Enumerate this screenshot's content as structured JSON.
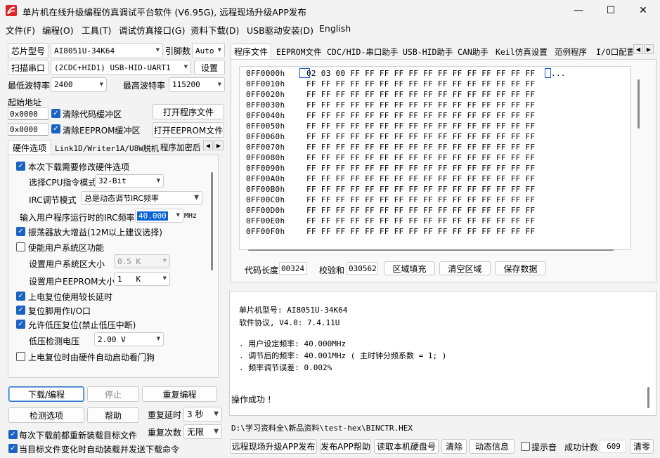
{
  "window": {
    "title": "单片机在线升级编程仿真调试平台软件 (V6.95G), 远程现场升级APP发布",
    "minimize": "—",
    "maximize": "☐",
    "close": "✕"
  },
  "menu": [
    "文件(F)",
    "编程(O)",
    "工具(T)",
    "调试仿真接口(G)",
    "资料下载(D)",
    "USB驱动安装(D)",
    "English"
  ],
  "left": {
    "chip_label": "芯片型号",
    "chip_value": "AI8051U-34K64",
    "pins_label": "引脚数",
    "pins_value": "Auto",
    "scan_label": "扫描串口",
    "port_value": "(2CDC+HID1) USB-HID-UART1",
    "settings_label": "设置",
    "min_baud_label": "最低波特率",
    "min_baud_value": "2400",
    "max_baud_label": "最高波特率",
    "max_baud_value": "115200",
    "start_addr_label": "起始地址",
    "code_addr": "0x0000",
    "clear_code_label": "清除代码缓冲区",
    "open_prog_label": "打开程序文件",
    "eeprom_addr": "0x0000",
    "clear_eeprom_label": "清除EEPROM缓冲区",
    "open_eeprom_label": "打开EEPROM文件",
    "tabs": [
      "硬件选项",
      "Link1D/Writer1A/U8W脱机",
      "程序加密后"
    ],
    "opts": {
      "modify_hw": "本次下载需要修改硬件选项",
      "cpu_label": "选择CPU指令模式",
      "cpu_value": "32-Bit",
      "irc_mode_label": "IRC调节模式",
      "irc_mode_value": "总是动态调节IRC频率",
      "irc_freq_label": "输入用户程序运行时的IRC频率",
      "irc_freq_value": "40.000",
      "irc_unit": "MHz",
      "osc_gain": "振荡器放大增益(12M以上建议选择)",
      "user_sys": "使能用户系统区功能",
      "sys_size_label": "设置用户系统区大小",
      "sys_size_value": "0.5 K",
      "eeprom_size_label": "设置用户EEPROM大小",
      "eeprom_size_value": "1   K",
      "por_delay": "上电复位使用较长延时",
      "reset_io": "复位脚用作I/O口",
      "lvr": "允许低压复位(禁止低压中断)",
      "lvd_label": "低压检测电压",
      "lvd_value": "2.00 V",
      "wdt": "上电复位时由硬件自动启动看门狗"
    },
    "download_label": "下载/编程",
    "stop_label": "停止",
    "reprogram_label": "重复编程",
    "detect_label": "检测选项",
    "help_label": "帮助",
    "repeat_delay_label": "重复延时",
    "repeat_delay_value": "3 秒",
    "repeat_count_label": "重复次数",
    "repeat_count_value": "无限",
    "reload_each": "每次下载前都重新装载目标文件",
    "auto_send": "当目标文件变化时自动装载并发送下载命令"
  },
  "right": {
    "tabs": [
      "程序文件",
      "EEPROM文件",
      "CDC/HID-串口助手",
      "USB-HID助手",
      "CAN助手",
      "Keil仿真设置",
      "范例程序",
      "I/O口配置"
    ],
    "hex": [
      {
        "addr": "0FF0000h",
        "bytes": "02 03 00 FF FF FF FF FF FF FF FF FF FF FF FF FF",
        "ascii": "..."
      },
      {
        "addr": "0FF0010h",
        "bytes": "FF FF FF FF FF FF FF FF FF FF FF FF FF FF FF FF",
        "ascii": ""
      },
      {
        "addr": "0FF0020h",
        "bytes": "FF FF FF FF FF FF FF FF FF FF FF FF FF FF FF FF",
        "ascii": ""
      },
      {
        "addr": "0FF0030h",
        "bytes": "FF FF FF FF FF FF FF FF FF FF FF FF FF FF FF FF",
        "ascii": ""
      },
      {
        "addr": "0FF0040h",
        "bytes": "FF FF FF FF FF FF FF FF FF FF FF FF FF FF FF FF",
        "ascii": ""
      },
      {
        "addr": "0FF0050h",
        "bytes": "FF FF FF FF FF FF FF FF FF FF FF FF FF FF FF FF",
        "ascii": ""
      },
      {
        "addr": "0FF0060h",
        "bytes": "FF FF FF FF FF FF FF FF FF FF FF FF FF FF FF FF",
        "ascii": ""
      },
      {
        "addr": "0FF0070h",
        "bytes": "FF FF FF FF FF FF FF FF FF FF FF FF FF FF FF FF",
        "ascii": ""
      },
      {
        "addr": "0FF0080h",
        "bytes": "FF FF FF FF FF FF FF FF FF FF FF FF FF FF FF FF",
        "ascii": ""
      },
      {
        "addr": "0FF0090h",
        "bytes": "FF FF FF FF FF FF FF FF FF FF FF FF FF FF FF FF",
        "ascii": ""
      },
      {
        "addr": "0FF00A0h",
        "bytes": "FF FF FF FF FF FF FF FF FF FF FF FF FF FF FF FF",
        "ascii": ""
      },
      {
        "addr": "0FF00B0h",
        "bytes": "FF FF FF FF FF FF FF FF FF FF FF FF FF FF FF FF",
        "ascii": ""
      },
      {
        "addr": "0FF00C0h",
        "bytes": "FF FF FF FF FF FF FF FF FF FF FF FF FF FF FF FF",
        "ascii": ""
      },
      {
        "addr": "0FF00D0h",
        "bytes": "FF FF FF FF FF FF FF FF FF FF FF FF FF FF FF FF",
        "ascii": ""
      },
      {
        "addr": "0FF00E0h",
        "bytes": "FF FF FF FF FF FF FF FF FF FF FF FF FF FF FF FF",
        "ascii": ""
      },
      {
        "addr": "0FF00F0h",
        "bytes": "FF FF FF FF FF FF FF FF FF FF FF FF FF FF FF FF",
        "ascii": ""
      }
    ],
    "code_len_label": "代码长度",
    "code_len_value": "00324",
    "checksum_label": "校验和",
    "checksum_value": "030562",
    "fill_label": "区域填充",
    "clear_label": "清空区域",
    "save_label": "保存数据",
    "info": {
      "line1": "单片机型号: AI8051U-34K64",
      "line2": "软件协议, V4.0: 7.4.11U",
      "line3": ". 用户设定频率: 40.000MHz",
      "line4": ". 调节后的频率: 40.001MHz ( 主时钟分频系数 = 1; )",
      "line5": ". 频率调节误差: 0.002%",
      "line6": "操作成功 !"
    },
    "filepath": "D:\\学习资料全\\新品资料\\test-hex\\BINCTR.HEX",
    "publish_label": "远程现场升级APP发布",
    "publish_help_label": "发布APP帮助",
    "read_disk_label": "读取本机硬盘号",
    "clear_btn_label": "清除",
    "dynamic_label": "动态信息",
    "tone_label": "提示音",
    "success_label": "成功计数",
    "success_value": "609",
    "clear_count_label": "清零"
  }
}
